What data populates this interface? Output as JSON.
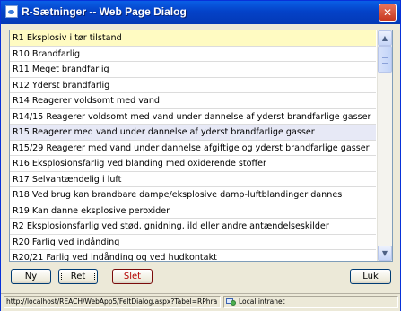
{
  "window": {
    "title": "R-Sætninger -- Web Page Dialog",
    "close_glyph": "✕"
  },
  "list": {
    "items": [
      "R1 Eksplosiv i tør tilstand",
      "R10 Brandfarlig",
      "R11 Meget brandfarlig",
      "R12 Yderst brandfarlig",
      "R14 Reagerer voldsomt med vand",
      "R14/15 Reagerer voldsomt med vand under dannelse af yderst brandfarlige gasser",
      "R15 Reagerer med vand under dannelse af yderst brandfarlige gasser",
      "R15/29 Reagerer med vand under dannelse afgiftige og yderst brandfarlige gasser",
      "R16 Eksplosionsfarlig ved blanding med oxiderende stoffer",
      "R17 Selvantændelig i luft",
      "R18 Ved brug kan brandbare dampe/eksplosive damp-luftblandinger dannes",
      "R19 Kan danne eksplosive peroxider",
      "R2 Eksplosionsfarlig ved stød, gnidning, ild eller andre antændelseskilder",
      "R20 Farlig ved indånding",
      "R20/21 Farlig ved indånding og ved hudkontakt"
    ],
    "selected_index": 0,
    "highlighted_index": 6
  },
  "scrollbar": {
    "up_glyph": "▲",
    "down_glyph": "▼"
  },
  "buttons": {
    "ny": "Ny",
    "ret": "Ret",
    "slet": "Slet",
    "luk": "Luk"
  },
  "statusbar": {
    "url": "http://localhost/REACH/WebApp5/FeltDialog.aspx?Tabel=RPhra",
    "zone": "Local intranet"
  },
  "icons": {
    "title": "document-icon",
    "zone": "intranet-icon",
    "close": "close-icon"
  },
  "colors": {
    "titlebar": "#0442c8",
    "selected_row": "#fffbc2",
    "highlighted_row": "#e7e9f6",
    "close_button": "#c7381f",
    "slet_text": "#b30000"
  }
}
